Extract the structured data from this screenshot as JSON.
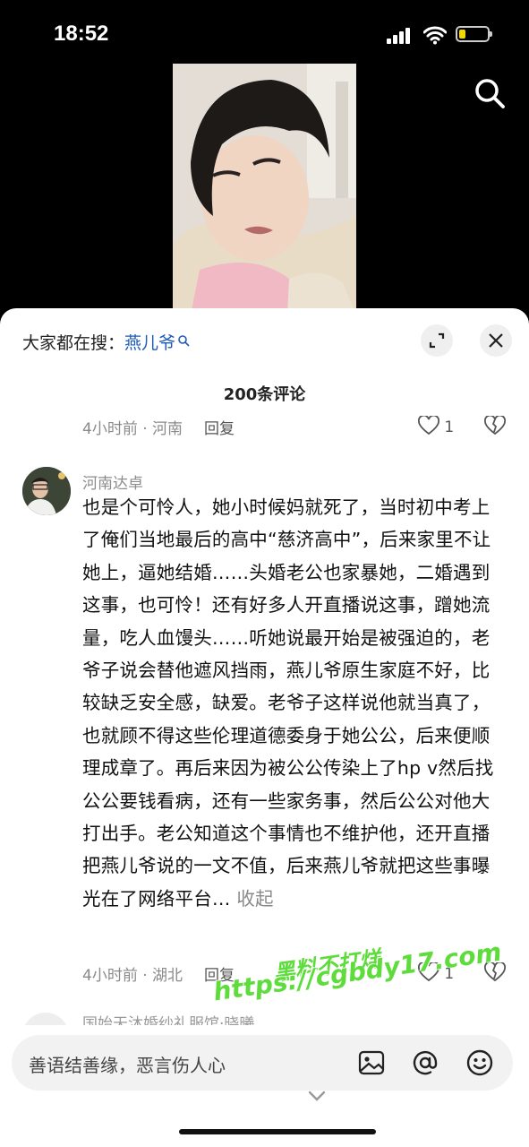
{
  "status": {
    "time": "18:52"
  },
  "hot_search": {
    "prefix": "大家都在搜：",
    "keyword": "燕儿爷"
  },
  "comments_count": "200条评论",
  "prev_comment": {
    "meta": "4小时前 · 河南",
    "reply": "回复",
    "likes": "1"
  },
  "comment": {
    "author": "河南达卓",
    "text": "也是个可怜人，她小时候妈就死了，当时初中考上了俺们当地最后的高中“慈济高中”，后来家里不让她上，逼她结婚……头婚老公也家暴她，二婚遇到这事，也可怜！还有好多人开直播说这事，蹭她流量，吃人血馒头……听她说最开始是被强迫的，老爷子说会替他遮风挡雨，燕儿爷原生家庭不好，比较缺乏安全感，缺爱。老爷子这样说他就当真了，也就顾不得这些伦理道德委身于她公公，后来便顺理成章了。再后来因为被公公传染上了hp v然后找公公要钱看病，还有一些家务事，然后公公对他大打出手。老公知道这个事情也不维护他，还开直播把燕儿爷说的一文不值，后来燕儿爷就把这些事曝光在了网络平台",
    "collapse": "收起",
    "meta": "4小时前 · 湖北",
    "reply": "回复",
    "likes": "1"
  },
  "next_comment": {
    "author": "国始天沐婚纱礼服馆·晓曦"
  },
  "input": {
    "placeholder": "善语结善缘，恶言伤人心"
  },
  "watermark": {
    "line1": "黑料不打烊",
    "line2": "https://cgbdy17.com"
  }
}
